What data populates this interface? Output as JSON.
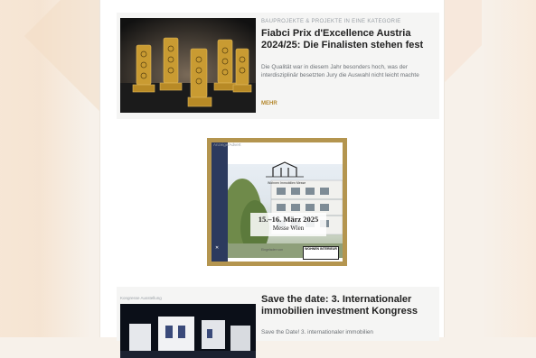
{
  "articles": [
    {
      "kicker": "Bauprojekte & Projekte in eine Kategorie",
      "title": "Fiabci Prix d'Excellence Austria 2024/25: Die Finalisten stehen fest",
      "excerpt": "Die Qualität war in diesem Jahr besonders hoch, was der interdisziplinär besetzten Jury die Auswahl nicht leicht machte",
      "more_label": "MEHR"
    },
    {
      "kicker": "Kongresse Ausstellung",
      "title": "Save the date: 3. Internationaler immobilien investment Kongress",
      "excerpt": "Save the Date! 3. internationaler immobilien"
    }
  ],
  "ad": {
    "tag": "Anzeige/Advert",
    "logo_text": "Wohnen Immobilien Messe",
    "date": "15.–16. März 2025",
    "location": "Messe Wien",
    "foot_text": "Eingeladen von",
    "foot_logo": "WOHNEN INTERIEUR"
  },
  "colors": {
    "ad_border": "#b4954f",
    "more": "#b5892f",
    "card_bg": "#f5f5f4"
  }
}
